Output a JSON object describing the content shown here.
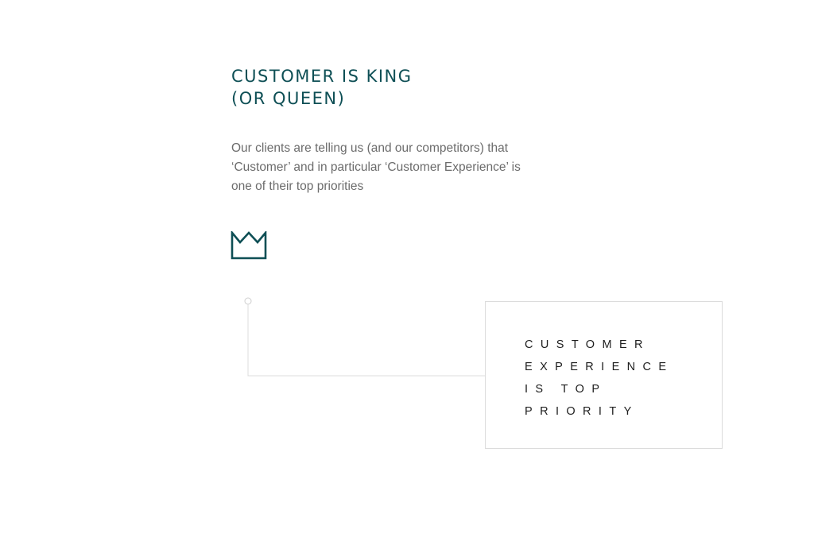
{
  "heading": {
    "lines": [
      "CUSTOMER IS KING",
      "(OR QUEEN)"
    ]
  },
  "intro": {
    "lines": [
      "Our clients are telling us (and our competitors) that",
      "‘Customer’ and in particular ‘Customer Experience’ is",
      "one of their top priorities"
    ]
  },
  "icon": {
    "name": "crown-icon",
    "color": "#0e4f55"
  },
  "callout": {
    "lines": [
      "CUSTOMER",
      "EXPERIENCE",
      "IS TOP",
      "PRIORITY"
    ]
  },
  "colors": {
    "heading": "#0e4f55",
    "body_text": "#6c6c6c",
    "callout_text": "#1e1e1e",
    "rule": "#dcdcdc"
  }
}
